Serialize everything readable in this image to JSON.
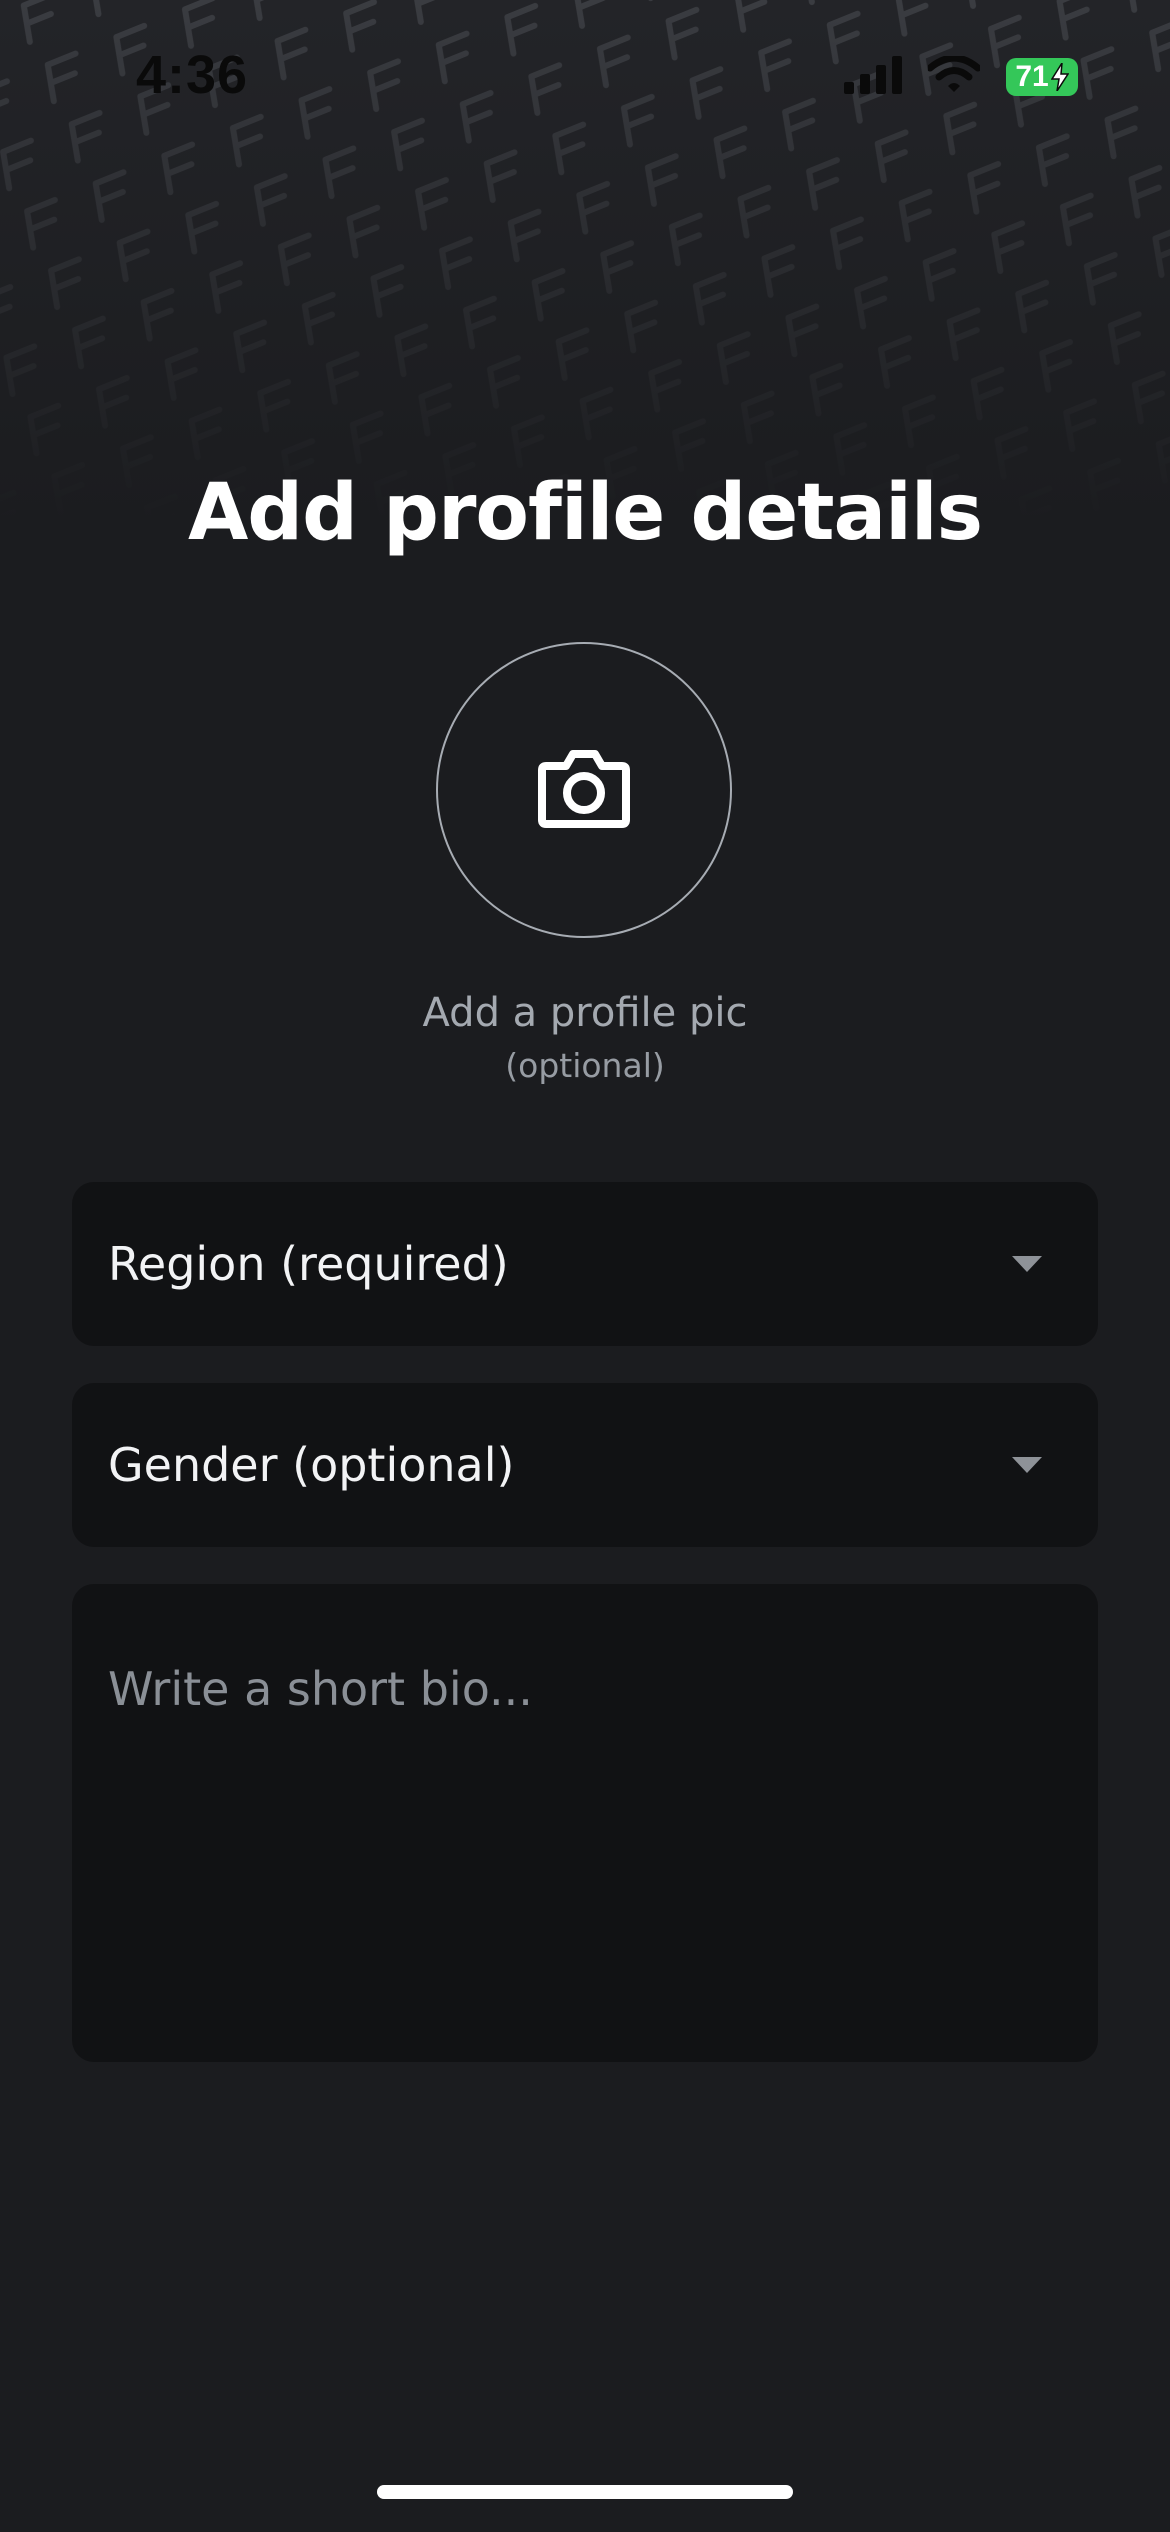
{
  "status_bar": {
    "time": "4:36",
    "battery_level": "71",
    "battery_charging": true,
    "signal_icon": "cellular-signal-icon",
    "wifi_icon": "wifi-icon"
  },
  "page": {
    "title": "Add profile details"
  },
  "avatar": {
    "icon": "camera-icon",
    "label": "Add a profile pic",
    "sublabel": "(optional)"
  },
  "form": {
    "region": {
      "label": "Region (required)",
      "icon": "chevron-down-icon"
    },
    "gender": {
      "label": "Gender (optional)",
      "icon": "chevron-down-icon"
    },
    "bio": {
      "placeholder": "Write a short bio..."
    }
  },
  "colors": {
    "background": "#1b1c1f",
    "field_background": "#111214",
    "battery": "#34c759",
    "muted_text": "#a4a9b0"
  }
}
